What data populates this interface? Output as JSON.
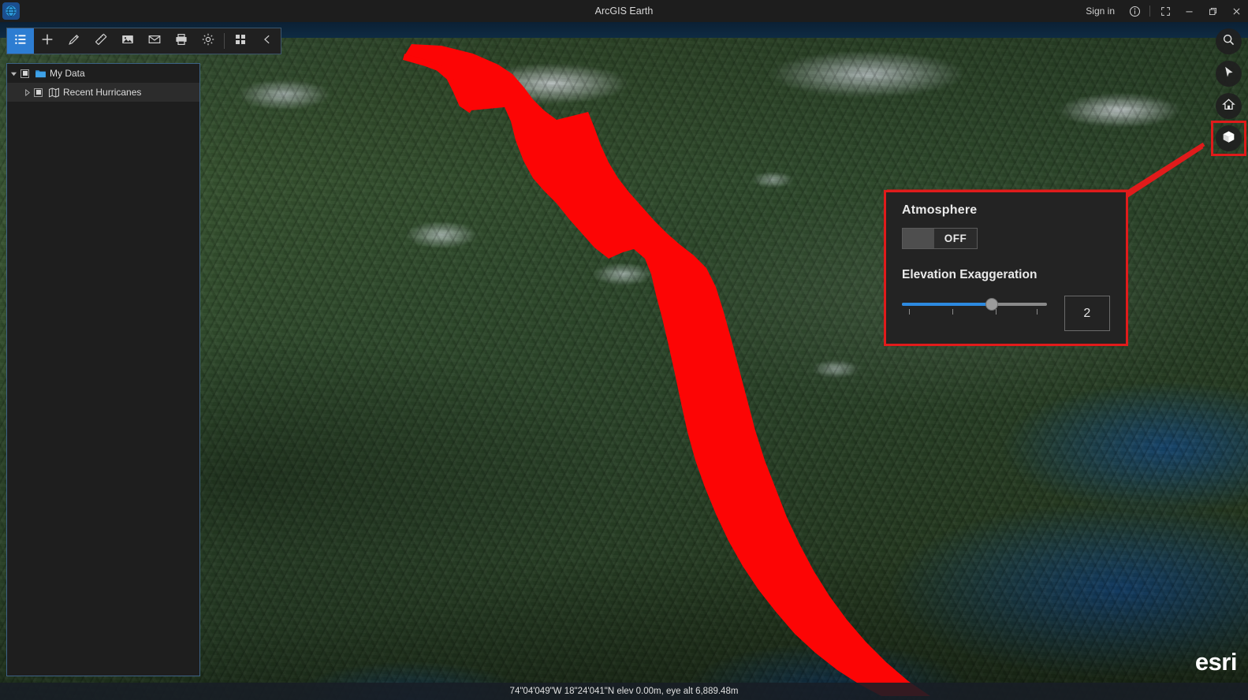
{
  "titlebar": {
    "app_icon": "arcgis-earth-globe-icon",
    "title": "ArcGIS Earth",
    "signin": "Sign in",
    "info_icon": "info-circle-icon",
    "fullscreen_icon": "fullscreen-icon",
    "minimize_icon": "minimize-icon",
    "maximize_icon": "maximize-icon",
    "close_icon": "close-icon"
  },
  "toolbar": {
    "items": [
      {
        "name": "table-of-contents",
        "icon": "list-icon",
        "active": true
      },
      {
        "name": "add-data",
        "icon": "plus-icon",
        "active": false
      },
      {
        "name": "draw",
        "icon": "pencil-icon",
        "active": false
      },
      {
        "name": "measure",
        "icon": "ruler-icon",
        "active": false
      },
      {
        "name": "capture-image",
        "icon": "image-icon",
        "active": false
      },
      {
        "name": "email",
        "icon": "envelope-icon",
        "active": false
      },
      {
        "name": "print",
        "icon": "printer-icon",
        "active": false
      },
      {
        "name": "settings",
        "icon": "gear-icon",
        "active": false
      },
      {
        "name": "apps",
        "icon": "grid-icon",
        "active": false
      },
      {
        "name": "collapse",
        "icon": "chevron-left-icon",
        "active": false
      }
    ]
  },
  "toc": {
    "root": {
      "label": "My Data",
      "icon": "folder-icon",
      "checked": true,
      "expanded": true
    },
    "children": [
      {
        "label": "Recent Hurricanes",
        "icon": "map-layer-icon",
        "checked": true,
        "expanded": false
      }
    ]
  },
  "right_tools": [
    {
      "name": "search",
      "icon": "search-icon",
      "highlighted": false
    },
    {
      "name": "navigate",
      "icon": "cursor-arrow-icon",
      "highlighted": false
    },
    {
      "name": "home",
      "icon": "home-icon",
      "highlighted": false
    },
    {
      "name": "display-settings",
      "icon": "cube-icon",
      "highlighted": true
    }
  ],
  "atmosphere_panel": {
    "title": "Atmosphere",
    "toggle_label": "OFF",
    "toggle_on": false,
    "exaggeration_title": "Elevation Exaggeration",
    "exaggeration_value": "2",
    "slider_percent": 62,
    "slider_ticks": [
      5,
      35,
      65,
      93
    ],
    "accent_color": "#2d8ae0",
    "highlight_color": "#e01b1b"
  },
  "statusbar": {
    "text": "74\"04'049\"W 18\"24'041\"N  elev 0.00m,  eye alt 6,889.48m"
  },
  "branding": {
    "logo_text": "esri"
  },
  "map": {
    "track_color": "#fc0505",
    "track_name": "recent-hurricane-track"
  }
}
